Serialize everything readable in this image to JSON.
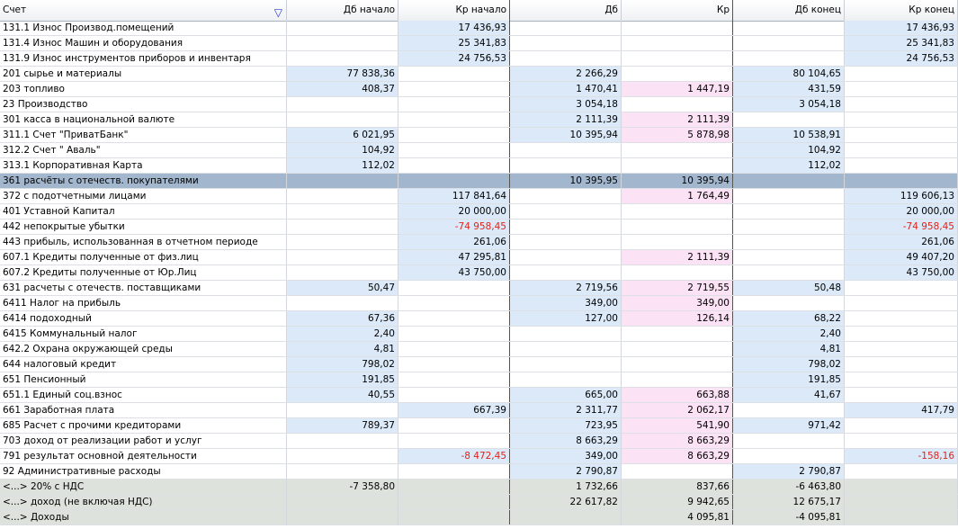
{
  "columns": [
    {
      "label": "Счет"
    },
    {
      "label": "Дб начало"
    },
    {
      "label": "Кр начало"
    },
    {
      "label": "Дб"
    },
    {
      "label": "Кр"
    },
    {
      "label": "Дб конец"
    },
    {
      "label": "Кр конец"
    }
  ],
  "filter_icon": "filter-funnel-icon",
  "colors": {
    "debit_bg": "#dbe9f8",
    "credit_bg": "#fbe2f4",
    "selected_row": "#a2b6ce",
    "total_row": "#dde2dc",
    "negative": "#e0231b"
  },
  "rows": [
    {
      "cells": [
        "131.1 Износ Производ.помещений",
        "",
        "17 436,93",
        "",
        "",
        "",
        "17 436,93"
      ]
    },
    {
      "cells": [
        "131.4 Износ Машин и оборудования",
        "",
        "25 341,83",
        "",
        "",
        "",
        "25 341,83"
      ]
    },
    {
      "cells": [
        "131.9 Износ инструментов приборов и инвентаря",
        "",
        "24 756,53",
        "",
        "",
        "",
        "24 756,53"
      ]
    },
    {
      "cells": [
        "201 сырье и материалы",
        "77 838,36",
        "",
        "2 266,29",
        "",
        "80 104,65",
        ""
      ]
    },
    {
      "cells": [
        "203 топливо",
        "408,37",
        "",
        "1 470,41",
        "1 447,19",
        "431,59",
        ""
      ]
    },
    {
      "cells": [
        "23 Производство",
        "",
        "",
        "3 054,18",
        "",
        "3 054,18",
        ""
      ]
    },
    {
      "cells": [
        "301 касса в национальной валюте",
        "",
        "",
        "2 111,39",
        "2 111,39",
        "",
        ""
      ]
    },
    {
      "cells": [
        "311.1 Счет \"ПриватБанк\"",
        "6 021,95",
        "",
        "10 395,94",
        "5 878,98",
        "10 538,91",
        ""
      ]
    },
    {
      "cells": [
        "312.2 Счет \" Аваль\"",
        "104,92",
        "",
        "",
        "",
        "104,92",
        ""
      ]
    },
    {
      "cells": [
        "313.1 Корпоративная Карта",
        "112,02",
        "",
        "",
        "",
        "112,02",
        ""
      ]
    },
    {
      "cells": [
        "361 расчёты с отечеств. покупателями",
        "",
        "",
        "10 395,95",
        "10 395,94",
        "",
        ""
      ],
      "selected": true
    },
    {
      "cells": [
        "372 с подотчетными лицами",
        "",
        "117 841,64",
        "",
        "1 764,49",
        "",
        "119 606,13"
      ]
    },
    {
      "cells": [
        "401 Уставной Капитал",
        "",
        "20 000,00",
        "",
        "",
        "",
        "20 000,00"
      ]
    },
    {
      "cells": [
        "442 непокрытые убытки",
        "",
        "-74 958,45",
        "",
        "",
        "",
        "-74 958,45"
      ]
    },
    {
      "cells": [
        "443 прибыль, использованная в отчетном периоде",
        "",
        "261,06",
        "",
        "",
        "",
        "261,06"
      ]
    },
    {
      "cells": [
        "607.1 Кредиты полученные от физ.лиц",
        "",
        "47 295,81",
        "",
        "2 111,39",
        "",
        "49 407,20"
      ]
    },
    {
      "cells": [
        "607.2 Кредиты полученные от Юр.Лиц",
        "",
        "43 750,00",
        "",
        "",
        "",
        "43 750,00"
      ]
    },
    {
      "cells": [
        "631 расчеты с отечеств. поставщиками",
        "50,47",
        "",
        "2 719,56",
        "2 719,55",
        "50,48",
        ""
      ]
    },
    {
      "cells": [
        "6411 Налог на прибыль",
        "",
        "",
        "349,00",
        "349,00",
        "",
        ""
      ]
    },
    {
      "cells": [
        "6414 подоходный",
        "67,36",
        "",
        "127,00",
        "126,14",
        "68,22",
        ""
      ]
    },
    {
      "cells": [
        "6415 Коммунальный налог",
        "2,40",
        "",
        "",
        "",
        "2,40",
        ""
      ]
    },
    {
      "cells": [
        "642.2 Охрана окружающей среды",
        "4,81",
        "",
        "",
        "",
        "4,81",
        ""
      ]
    },
    {
      "cells": [
        "644 налоговый кредит",
        "798,02",
        "",
        "",
        "",
        "798,02",
        ""
      ]
    },
    {
      "cells": [
        "651 Пенсионный",
        "191,85",
        "",
        "",
        "",
        "191,85",
        ""
      ]
    },
    {
      "cells": [
        "651.1 Единый соц.взнос",
        "40,55",
        "",
        "665,00",
        "663,88",
        "41,67",
        ""
      ]
    },
    {
      "cells": [
        "661 Заработная плата",
        "",
        "667,39",
        "2 311,77",
        "2 062,17",
        "",
        "417,79"
      ]
    },
    {
      "cells": [
        "685 Расчет с прочими кредиторами",
        "789,37",
        "",
        "723,95",
        "541,90",
        "971,42",
        ""
      ]
    },
    {
      "cells": [
        "703 доход от реализации работ и услуг",
        "",
        "",
        "8 663,29",
        "8 663,29",
        "",
        ""
      ]
    },
    {
      "cells": [
        "791 результат основной деятельности",
        "",
        "-8 472,45",
        "349,00",
        "8 663,29",
        "",
        "-158,16"
      ]
    },
    {
      "cells": [
        "92 Административные расходы",
        "",
        "",
        "2 790,87",
        "",
        "2 790,87",
        ""
      ]
    },
    {
      "cells": [
        "<...> 20% с НДС",
        "-7 358,80",
        "",
        "1 732,66",
        "837,66",
        "-6 463,80",
        ""
      ],
      "total": true
    },
    {
      "cells": [
        "<...> доход (не включая НДС)",
        "",
        "",
        "22 617,82",
        "9 942,65",
        "12 675,17",
        ""
      ],
      "total": true
    },
    {
      "cells": [
        "<...> Доходы",
        "",
        "",
        "",
        "4 095,81",
        "-4 095,81",
        ""
      ],
      "total": true
    }
  ]
}
